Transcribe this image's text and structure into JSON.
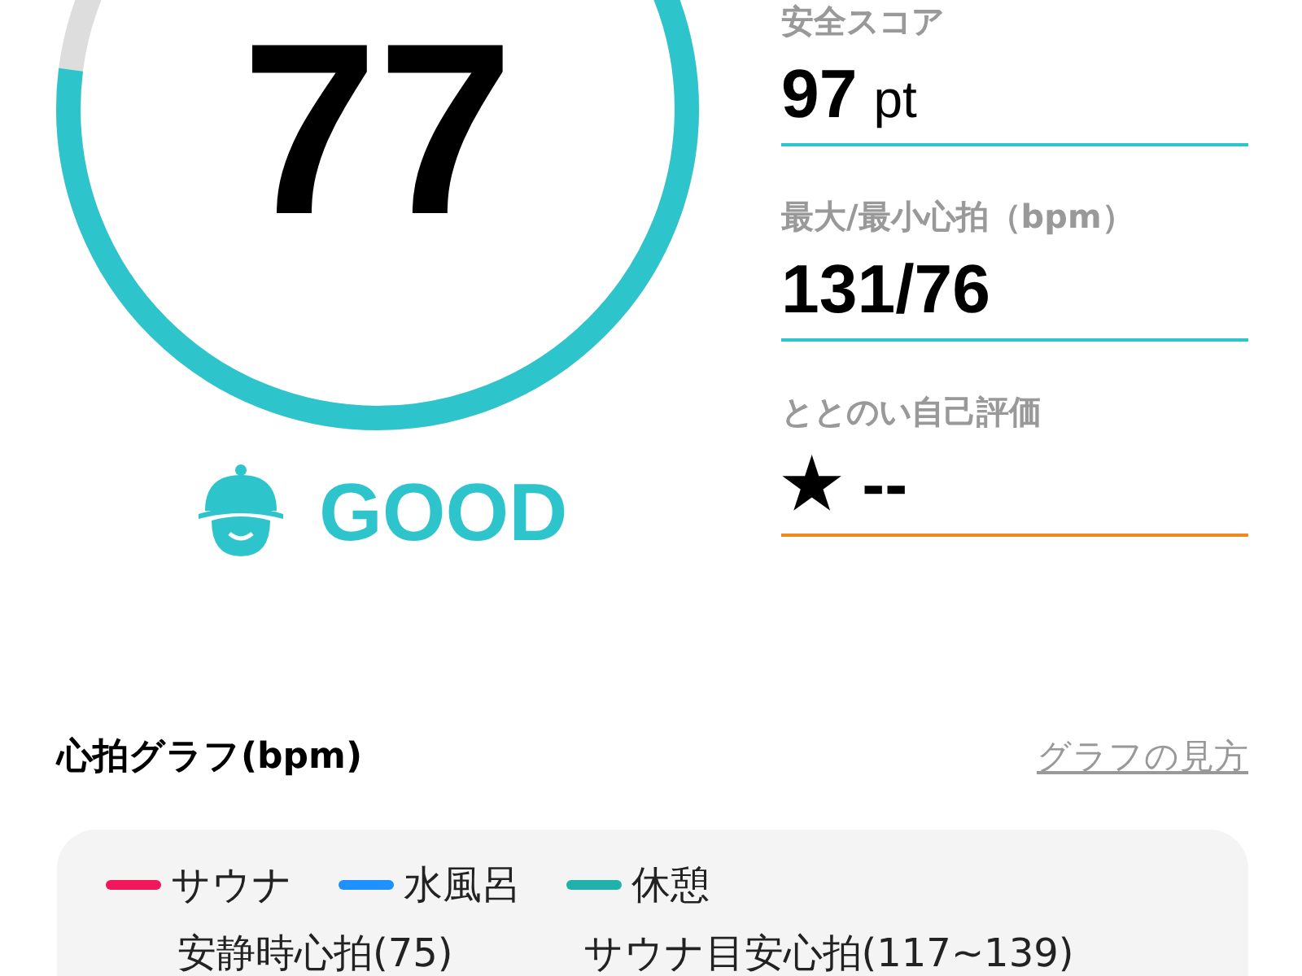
{
  "score": {
    "value": "77",
    "rating": "GOOD"
  },
  "stats": [
    {
      "label": "安全スコア",
      "value": "97",
      "unit": "pt",
      "color": "#2ec4cc"
    },
    {
      "label": "最大/最小心拍（bpm）",
      "value": "131/76",
      "color": "#2ec4cc"
    },
    {
      "label": "ととのい自己評価",
      "value": "★ --",
      "color": "#f08a1c"
    }
  ],
  "graph": {
    "title": "心拍グラフ(bpm)",
    "help_link": "グラフの見方",
    "legend": [
      {
        "label": "サウナ",
        "color": "#f0185a"
      },
      {
        "label": "水風呂",
        "color": "#1e90ff"
      },
      {
        "label": "休憩",
        "color": "#20b2aa"
      }
    ],
    "references": [
      "安静時心拍(75)",
      "サウナ目安心拍(117~139)"
    ]
  }
}
